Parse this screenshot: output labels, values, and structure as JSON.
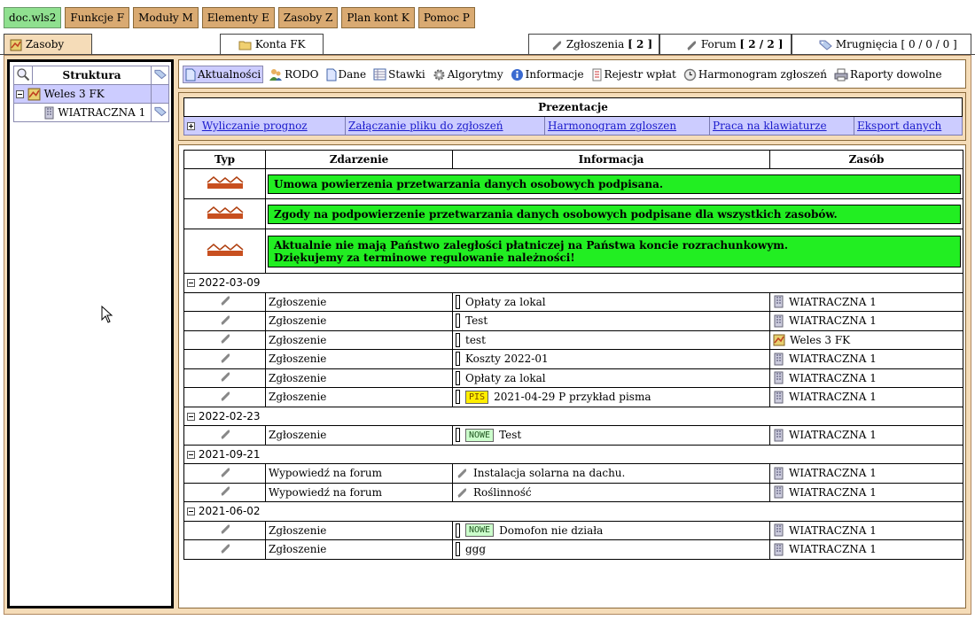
{
  "menu": {
    "app_label": "doc.wls2",
    "items": [
      "Funkcje F",
      "Moduły M",
      "Elementy E",
      "Zasoby Z",
      "Plan kont K",
      "Pomoc P"
    ]
  },
  "tabs": {
    "zasoby": "Zasoby",
    "konta": "Konta FK",
    "zgloszenia_label": "Zgłoszenia",
    "zgloszenia_count": "[ 2 ]",
    "forum_label": "Forum",
    "forum_count": "[ 2 / 2 ]",
    "mrug_label": "Mrugnięcia",
    "mrug_count": "[ 0 / 0 / 0 ]"
  },
  "tree": {
    "header": "Struktura",
    "root": "Weles 3 FK",
    "child": "WIATRACZNA 1"
  },
  "toolbar": [
    "Aktualności",
    "RODO",
    "Dane",
    "Stawki",
    "Algorytmy",
    "Informacje",
    "Rejestr wpłat",
    "Harmonogram zgłoszeń",
    "Raporty dowolne"
  ],
  "prezentacje": {
    "title": "Prezentacje",
    "links": [
      "Wyliczanie prognoz",
      "Załączanie pliku do zgłoszeń",
      "Harmonogram zgloszen",
      "Praca na klawiaturze",
      "Eksport danych"
    ]
  },
  "events": {
    "headers": [
      "Typ",
      "Zdarzenie",
      "Informacja",
      "Zasób"
    ],
    "notices": [
      "Umowa powierzenia przetwarzania danych osobowych podpisana.",
      "Zgody na podpowierzenie przetwarzania danych osobowych podpisane dla wszystkich zasobów.",
      "Aktualnie nie mają Państwo zaległości płatniczej na Państwa koncie rozrachunkowym.",
      "Dziękujemy za terminowe regulowanie należności!"
    ],
    "groups": [
      {
        "date": "2022-03-09",
        "rows": [
          {
            "event": "Zgłoszenie",
            "info": "Opłaty za lokal",
            "res": "WIATRACZNA 1"
          },
          {
            "event": "Zgłoszenie",
            "info": "Test",
            "res": "WIATRACZNA 1"
          },
          {
            "event": "Zgłoszenie",
            "info": "test",
            "res": "Weles 3 FK"
          },
          {
            "event": "Zgłoszenie",
            "info": "Koszty 2022-01",
            "res": "WIATRACZNA 1"
          },
          {
            "event": "Zgłoszenie",
            "info": "Opłaty za lokal",
            "res": "WIATRACZNA 1"
          },
          {
            "event": "Zgłoszenie",
            "badge": "PIS",
            "info": "2021-04-29 P przykład pisma",
            "res": "WIATRACZNA 1"
          }
        ]
      },
      {
        "date": "2022-02-23",
        "rows": [
          {
            "event": "Zgłoszenie",
            "badge": "NOWE",
            "info": "Test",
            "res": "WIATRACZNA 1"
          }
        ]
      },
      {
        "date": "2021-09-21",
        "rows": [
          {
            "event": "Wypowiedź na forum",
            "info": "Instalacja solarna na dachu.",
            "res": "WIATRACZNA 1"
          },
          {
            "event": "Wypowiedź na forum",
            "info": "Roślinność",
            "res": "WIATRACZNA 1"
          }
        ]
      },
      {
        "date": "2021-06-02",
        "rows": [
          {
            "event": "Zgłoszenie",
            "badge": "NOWE",
            "info": "Domofon nie działa",
            "res": "WIATRACZNA 1"
          },
          {
            "event": "Zgłoszenie",
            "info": "ggg",
            "res": "WIATRACZNA 1"
          }
        ]
      }
    ]
  },
  "colors": {
    "menu_bg": "#d9aa72",
    "app_bg": "#8fe08f",
    "panel_bg": "#f5dcb8",
    "highlight": "#ccccff",
    "notice_green": "#22ee22",
    "link": "#1a1acc"
  }
}
